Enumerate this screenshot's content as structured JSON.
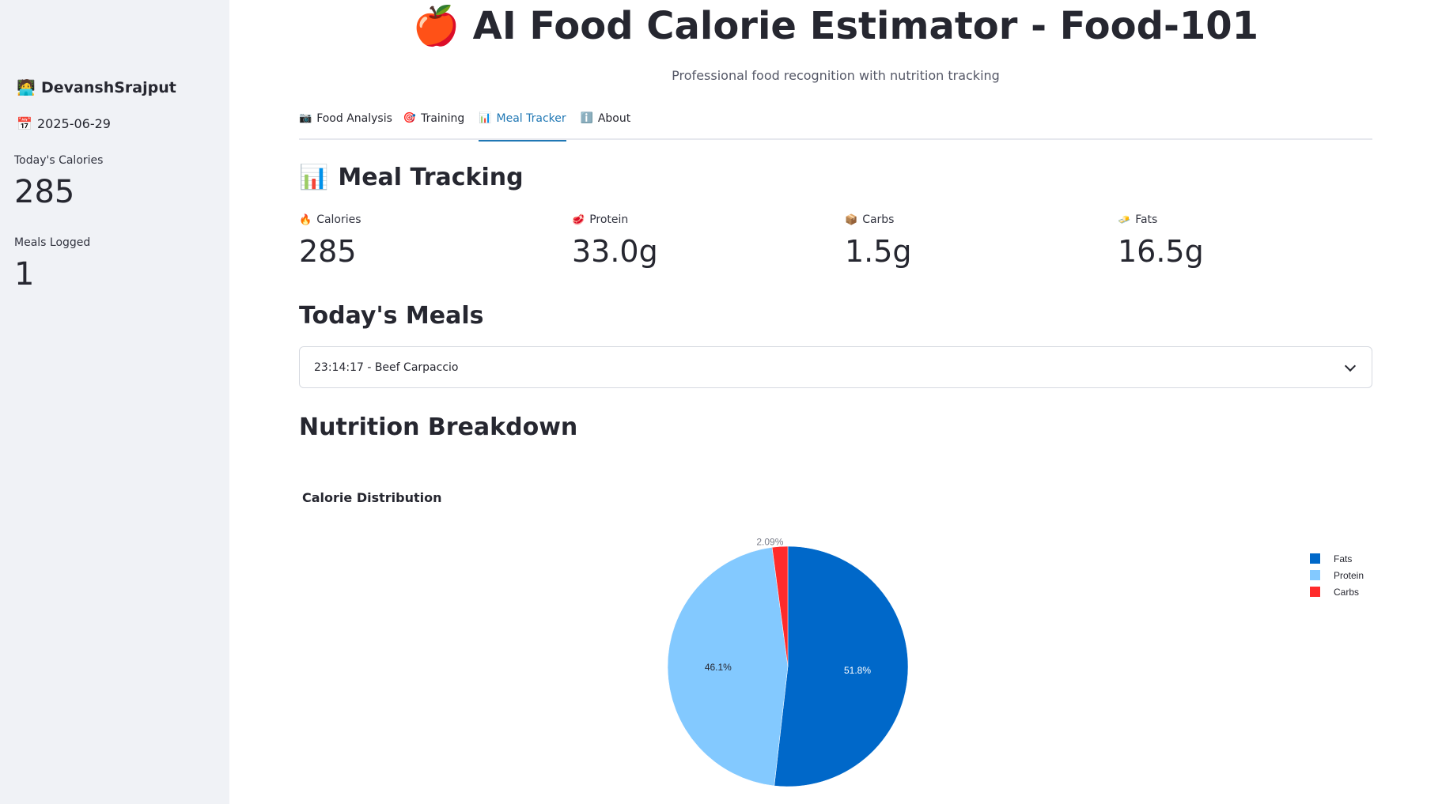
{
  "sidebar": {
    "user_icon": "person-at-laptop-icon",
    "username": "DevanshSrajput",
    "date_icon": "calendar-icon",
    "date": "2025-06-29",
    "metrics": [
      {
        "label": "Today's Calories",
        "value": "285"
      },
      {
        "label": "Meals Logged",
        "value": "1"
      }
    ]
  },
  "header": {
    "title_icon": "apple-icon",
    "title": "AI Food Calorie Estimator - Food-101",
    "subtitle": "Professional food recognition with nutrition tracking"
  },
  "tabs": [
    {
      "icon": "camera-icon",
      "label": "Food Analysis",
      "active": false
    },
    {
      "icon": "target-icon",
      "label": "Training",
      "active": false
    },
    {
      "icon": "chart-icon",
      "label": "Meal Tracker",
      "active": true
    },
    {
      "icon": "info-icon",
      "label": "About",
      "active": false
    }
  ],
  "meal_tracking": {
    "icon": "bar-chart-icon",
    "heading": "Meal Tracking",
    "metrics": [
      {
        "icon": "fire-icon",
        "label": "Calories",
        "value": "285"
      },
      {
        "icon": "meat-icon",
        "label": "Protein",
        "value": "33.0g"
      },
      {
        "icon": "box-icon",
        "label": "Carbs",
        "value": "1.5g"
      },
      {
        "icon": "butter-icon",
        "label": "Fats",
        "value": "16.5g"
      }
    ]
  },
  "todays_meals": {
    "heading": "Today's Meals",
    "expander_label": "23:14:17 - Beef Carpaccio"
  },
  "nutrition": {
    "heading": "Nutrition Breakdown"
  },
  "colors": {
    "fats": "#0068c9",
    "protein": "#83c9ff",
    "carbs": "#ff2b2b",
    "accent": "#1f77b4"
  },
  "chart_data": {
    "type": "pie",
    "title": "Calorie Distribution",
    "labels": [
      "Fats",
      "Protein",
      "Carbs"
    ],
    "values": [
      51.8,
      46.1,
      2.09
    ],
    "data_labels": [
      "51.8%",
      "46.1%",
      "2.09%"
    ],
    "legend": "top-right"
  }
}
